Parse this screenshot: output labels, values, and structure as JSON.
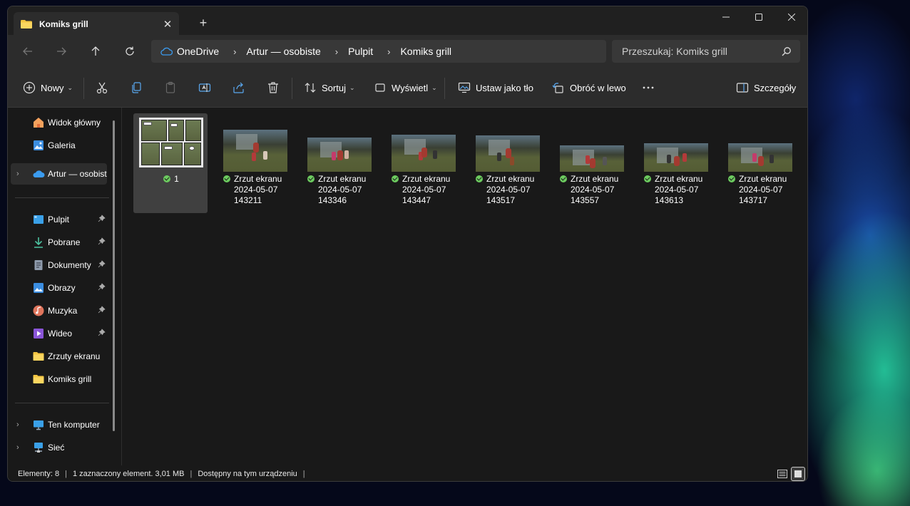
{
  "tab": {
    "title": "Komiks grill"
  },
  "breadcrumbs": [
    "OneDrive",
    "Artur — osobiste",
    "Pulpit",
    "Komiks grill"
  ],
  "search": {
    "placeholder": "Przeszukaj: Komiks grill"
  },
  "toolbar": {
    "new_label": "Nowy",
    "sort_label": "Sortuj",
    "view_label": "Wyświetl",
    "set_bg_label": "Ustaw jako tło",
    "rotate_label": "Obróć w lewo",
    "details_label": "Szczegóły"
  },
  "sidebar": {
    "top": [
      {
        "label": "Widok główny",
        "icon": "home-icon"
      },
      {
        "label": "Galeria",
        "icon": "gallery-icon"
      },
      {
        "label": "Artur — osobist",
        "icon": "onedrive-cloud-icon"
      }
    ],
    "pinned": [
      {
        "label": "Pulpit",
        "icon": "desktop-icon"
      },
      {
        "label": "Pobrane",
        "icon": "download-icon"
      },
      {
        "label": "Dokumenty",
        "icon": "documents-icon"
      },
      {
        "label": "Obrazy",
        "icon": "pictures-icon"
      },
      {
        "label": "Muzyka",
        "icon": "music-icon"
      },
      {
        "label": "Wideo",
        "icon": "video-icon"
      },
      {
        "label": "Zrzuty ekranu",
        "icon": "folder-icon"
      },
      {
        "label": "Komiks grill",
        "icon": "folder-icon"
      }
    ],
    "bottom": [
      {
        "label": "Ten komputer",
        "icon": "computer-icon"
      },
      {
        "label": "Sieć",
        "icon": "network-icon"
      }
    ]
  },
  "files": [
    {
      "name": "1",
      "line2": "",
      "line3": ""
    },
    {
      "name": "Zrzut ekranu",
      "line2": "2024-05-07",
      "line3": "143211"
    },
    {
      "name": "Zrzut ekranu",
      "line2": "2024-05-07",
      "line3": "143346"
    },
    {
      "name": "Zrzut ekranu",
      "line2": "2024-05-07",
      "line3": "143447"
    },
    {
      "name": "Zrzut ekranu",
      "line2": "2024-05-07",
      "line3": "143517"
    },
    {
      "name": "Zrzut ekranu",
      "line2": "2024-05-07",
      "line3": "143557"
    },
    {
      "name": "Zrzut ekranu",
      "line2": "2024-05-07",
      "line3": "143613"
    },
    {
      "name": "Zrzut ekranu",
      "line2": "2024-05-07",
      "line3": "143717"
    }
  ],
  "status": {
    "count": "Elementy: 8",
    "selected": "1 zaznaczony element. 3,01 MB",
    "availability": "Dostępny na tym urządzeniu"
  },
  "colors": {
    "folder": "#f4c542",
    "onedrive": "#3b9cf0",
    "sync_ok": "#6ccb5f"
  }
}
